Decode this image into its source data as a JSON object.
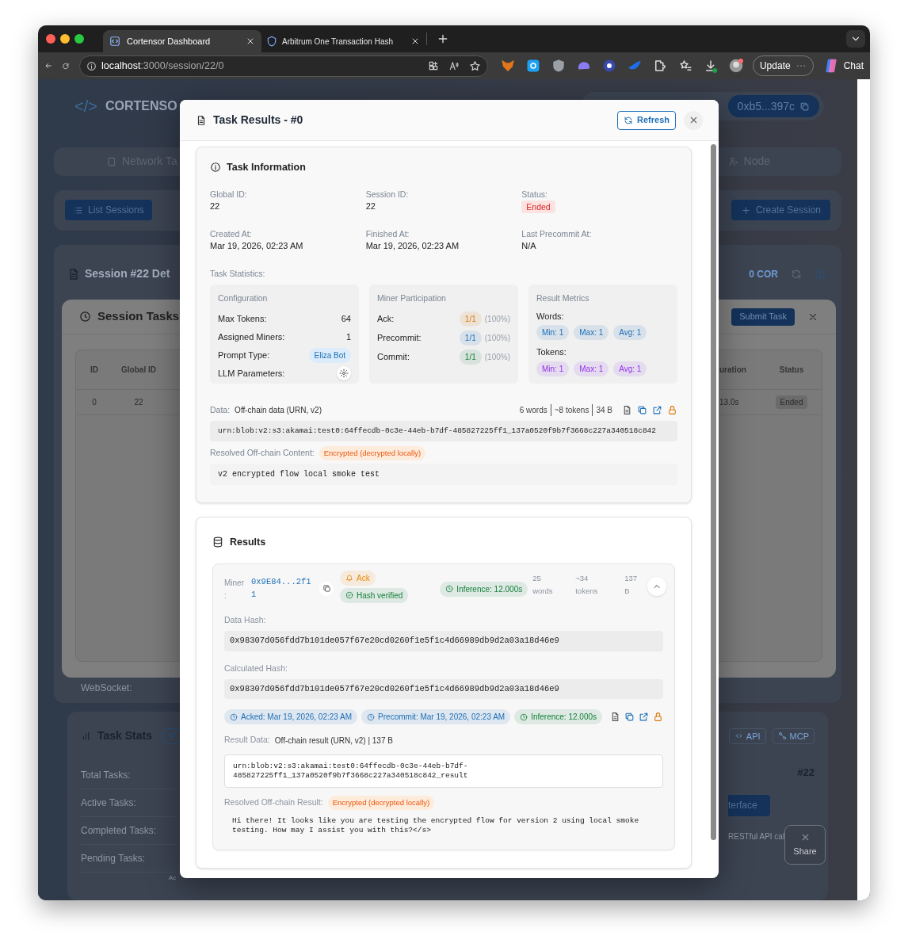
{
  "browser": {
    "tabs": [
      {
        "title": "Cortensor Dashboard",
        "selected": true
      },
      {
        "title": "Arbitrum One Transaction Hash",
        "selected": false
      }
    ],
    "url_host": "localhost",
    "url_path": ":3000/session/22/0",
    "update_button": "Update",
    "chat_button": "Chat"
  },
  "dashboard": {
    "logo_mark": "</>",
    "brand": "CORTENSO",
    "wallet": "0xb5...397c",
    "nav_tabs": [
      "Network Ta",
      "Node"
    ],
    "list_sessions_button": "List Sessions",
    "create_session_button": "Create Session",
    "session_title": "Session #22 Det",
    "stake_label": "0 COR",
    "websocket_label": "WebSocket:",
    "task_stats": {
      "title": "Task Stats",
      "buttons": [
        "API",
        "MCP"
      ],
      "rows": [
        "Total Tasks:",
        "Active Tasks:",
        "Completed Tasks:",
        "Pending Tasks:"
      ],
      "footnote": "Ac"
    },
    "session_number": "#22",
    "interface_button": "terface",
    "api_text": "RESTful API cal",
    "share_button": "Share"
  },
  "session_tasks_dialog": {
    "title": "Session Tasks",
    "submit_button": "Submit Task",
    "columns": [
      "ID",
      "Global ID",
      "uration",
      "Status"
    ],
    "rows": [
      {
        "id": "0",
        "global_id": "22",
        "duration": "13.0s",
        "status": "Ended"
      }
    ]
  },
  "task_results_dialog": {
    "title": "Task Results - #0",
    "refresh_button": "Refresh",
    "task_information": {
      "title": "Task Information",
      "fields": [
        {
          "label": "Global ID:",
          "value": "22",
          "kind": "text"
        },
        {
          "label": "Session ID:",
          "value": "22",
          "kind": "text"
        },
        {
          "label": "Status:",
          "value": "Ended",
          "kind": "badge"
        },
        {
          "label": "Created At:",
          "value": "Mar 19, 2026, 02:23 AM",
          "kind": "text"
        },
        {
          "label": "Finished At:",
          "value": "Mar 19, 2026, 02:23 AM",
          "kind": "text"
        },
        {
          "label": "Last Precommit At:",
          "value": "N/A",
          "kind": "text"
        }
      ],
      "statistics_label": "Task Statistics:",
      "configuration": {
        "title": "Configuration",
        "rows": [
          {
            "label": "Max Tokens:",
            "kind": "text",
            "value": "64"
          },
          {
            "label": "Assigned Miners:",
            "kind": "text",
            "value": "1"
          },
          {
            "label": "Prompt Type:",
            "kind": "badge",
            "value": "Eliza Bot"
          },
          {
            "label": "LLM Parameters:",
            "kind": "settings"
          }
        ]
      },
      "miner_participation": {
        "title": "Miner Participation",
        "rows": [
          {
            "label": "Ack:",
            "count": "1/1",
            "percent": "(100%)",
            "kind": "ack"
          },
          {
            "label": "Precommit:",
            "count": "1/1",
            "percent": "(100%)",
            "kind": "precommit"
          },
          {
            "label": "Commit:",
            "count": "1/1",
            "percent": "(100%)",
            "kind": "commit"
          }
        ]
      },
      "result_metrics": {
        "title": "Result Metrics",
        "groups": [
          {
            "label": "Words:",
            "kind": "words",
            "pills": [
              "Min: 1",
              "Max: 1",
              "Avg: 1"
            ]
          },
          {
            "label": "Tokens:",
            "kind": "tokens",
            "pills": [
              "Min: 1",
              "Max: 1",
              "Avg: 1"
            ]
          }
        ]
      },
      "data_label": "Data:",
      "data_kind": "Off-chain data (URN, v2)",
      "data_stats": [
        "6 words",
        "~8 tokens",
        "34 B"
      ],
      "urn": "urn:blob:v2:s3:akamai:test0:64ffecdb-0c3e-44eb-b7df-485827225ff1_137a0520f9b7f3668c227a340518c842",
      "resolved_label": "Resolved Off-chain Content:",
      "encryption_badge": "Encrypted (decrypted locally)",
      "content": "v2 encrypted flow local smoke test"
    },
    "results": {
      "title": "Results",
      "miners": [
        {
          "expanded": true,
          "label": "Miner :",
          "address": "0x9E84...2f11",
          "badges": [
            {
              "kind": "ack",
              "label": "Ack"
            },
            {
              "kind": "verified",
              "label": "Hash verified"
            }
          ],
          "inference": "Inference: 12.000s",
          "stats": [
            "25 words",
            "~34 tokens",
            "137 B"
          ],
          "data_hash_label": "Data Hash:",
          "data_hash": "0x98307d056fdd7b101de057f67e20cd0260f1e5f1c4d66989db9d2a03a18d46e9",
          "calculated_hash_label": "Calculated Hash:",
          "calculated_hash": "0x98307d056fdd7b101de057f67e20cd0260f1e5f1c4d66989db9d2a03a18d46e9",
          "timeline": [
            {
              "label": "Acked: Mar 19, 2026, 02:23 AM",
              "kind": "acked"
            },
            {
              "label": "Precommit: Mar 19, 2026, 02:23 AM",
              "kind": "precommit"
            },
            {
              "label": "Inference: 12.000s",
              "kind": "inference"
            }
          ],
          "result_data_label": "Result Data:",
          "result_data_kind": "Off-chain result (URN, v2) | 137 B",
          "result_urn": "urn:blob:v2:s3:akamai:test0:64ffecdb-0c3e-44eb-b7df-485827225ff1_137a0520f9b7f3668c227a340518c842_result",
          "resolved_label": "Resolved Off-chain Result:",
          "encryption_badge": "Encrypted (decrypted locally)",
          "content": "Hi there! It looks like you are testing the encrypted flow for version 2 using local smoke testing. How may I assist you with this?</s>"
        }
      ]
    }
  }
}
